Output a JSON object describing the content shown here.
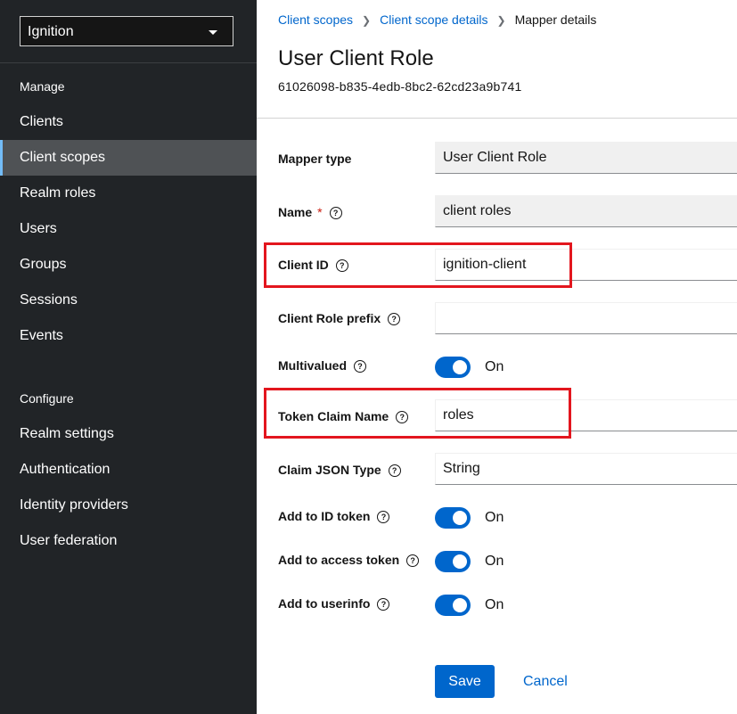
{
  "sidebar": {
    "realm": "Ignition",
    "manage_title": "Manage",
    "manage_items": [
      {
        "label": "Clients"
      },
      {
        "label": "Client scopes"
      },
      {
        "label": "Realm roles"
      },
      {
        "label": "Users"
      },
      {
        "label": "Groups"
      },
      {
        "label": "Sessions"
      },
      {
        "label": "Events"
      }
    ],
    "configure_title": "Configure",
    "configure_items": [
      {
        "label": "Realm settings"
      },
      {
        "label": "Authentication"
      },
      {
        "label": "Identity providers"
      },
      {
        "label": "User federation"
      }
    ],
    "active_item": "Client scopes"
  },
  "breadcrumb": {
    "items": [
      "Client scopes",
      "Client scope details",
      "Mapper details"
    ]
  },
  "page": {
    "title": "User Client Role",
    "id": "61026098-b835-4edb-8bc2-62cd23a9b741"
  },
  "form": {
    "mapper_type": {
      "label": "Mapper type",
      "value": "User Client Role"
    },
    "name": {
      "label": "Name",
      "required_mark": "*",
      "value": "client roles"
    },
    "client_id": {
      "label": "Client ID",
      "value": "ignition-client"
    },
    "client_role_prefix": {
      "label": "Client Role prefix",
      "value": ""
    },
    "multivalued": {
      "label": "Multivalued",
      "state": "On"
    },
    "token_claim_name": {
      "label": "Token Claim Name",
      "value": "roles"
    },
    "claim_json_type": {
      "label": "Claim JSON Type",
      "value": "String"
    },
    "add_to_id_token": {
      "label": "Add to ID token",
      "state": "On"
    },
    "add_to_access_token": {
      "label": "Add to access token",
      "state": "On"
    },
    "add_to_userinfo": {
      "label": "Add to userinfo",
      "state": "On"
    }
  },
  "actions": {
    "save": "Save",
    "cancel": "Cancel"
  },
  "help_glyph": "?",
  "colors": {
    "primary": "#0066cc",
    "sidebar_bg": "#212427",
    "highlight": "#e3161e"
  }
}
